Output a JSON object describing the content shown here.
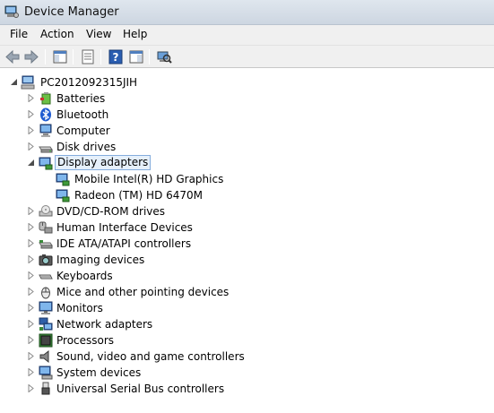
{
  "window": {
    "title": "Device Manager"
  },
  "menu": [
    {
      "label": "File"
    },
    {
      "label": "Action"
    },
    {
      "label": "View"
    },
    {
      "label": "Help"
    }
  ],
  "toolbar": [
    {
      "icon": "back-arrow-icon"
    },
    {
      "icon": "forward-arrow-icon"
    },
    {
      "icon": "show-hide-console-tree-icon"
    },
    {
      "icon": "properties-icon"
    },
    {
      "icon": "help-icon"
    },
    {
      "icon": "action-pane-icon"
    },
    {
      "icon": "scan-hardware-changes-icon"
    }
  ],
  "tree": {
    "root": {
      "label": "PC2012092315JIH",
      "icon": "computer-icon",
      "expanded": true
    },
    "items": [
      {
        "label": "Batteries",
        "icon": "battery-icon",
        "expanded": false
      },
      {
        "label": "Bluetooth",
        "icon": "bluetooth-icon",
        "expanded": false
      },
      {
        "label": "Computer",
        "icon": "computer-icon",
        "expanded": false
      },
      {
        "label": "Disk drives",
        "icon": "disk-drive-icon",
        "expanded": false
      },
      {
        "label": "Display adapters",
        "icon": "display-adapter-icon",
        "expanded": true,
        "selected": true,
        "children": [
          {
            "label": "Mobile Intel(R) HD Graphics",
            "icon": "display-adapter-icon"
          },
          {
            "label": "Radeon (TM) HD 6470M",
            "icon": "display-adapter-icon"
          }
        ]
      },
      {
        "label": "DVD/CD-ROM drives",
        "icon": "dvd-drive-icon",
        "expanded": false
      },
      {
        "label": "Human Interface Devices",
        "icon": "hid-icon",
        "expanded": false
      },
      {
        "label": "IDE ATA/ATAPI controllers",
        "icon": "ide-controller-icon",
        "expanded": false
      },
      {
        "label": "Imaging devices",
        "icon": "camera-icon",
        "expanded": false
      },
      {
        "label": "Keyboards",
        "icon": "keyboard-icon",
        "expanded": false
      },
      {
        "label": "Mice and other pointing devices",
        "icon": "mouse-icon",
        "expanded": false
      },
      {
        "label": "Monitors",
        "icon": "monitor-icon",
        "expanded": false
      },
      {
        "label": "Network adapters",
        "icon": "network-adapter-icon",
        "expanded": false
      },
      {
        "label": "Processors",
        "icon": "processor-icon",
        "expanded": false
      },
      {
        "label": "Sound, video and game controllers",
        "icon": "speaker-icon",
        "expanded": false
      },
      {
        "label": "System devices",
        "icon": "system-devices-icon",
        "expanded": false
      },
      {
        "label": "Universal Serial Bus controllers",
        "icon": "usb-icon",
        "expanded": false
      }
    ]
  },
  "colors": {
    "selection_border": "#84acdd",
    "selection_fill": "#e6f0fb",
    "titlebar": "#d6dee8"
  }
}
